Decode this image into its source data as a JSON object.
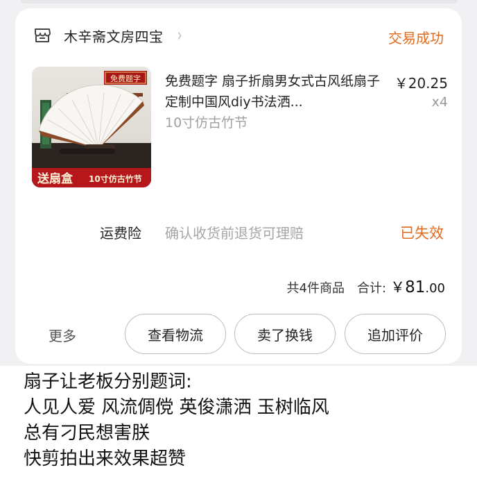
{
  "order": {
    "shop_name": "木辛斋文房四宝",
    "chevron": "›",
    "status": "交易成功",
    "item": {
      "title": "免费题字 扇子折扇男女式古风纸扇子定制中国风diy书法洒...",
      "sku": "10寸仿古竹节",
      "price": "￥20.25",
      "qty": "x4",
      "thumb_badge": "免费题字",
      "thumb_left_text": "送扇盒",
      "thumb_right_text": "10寸仿古竹节"
    },
    "insurance": {
      "label": "运费险",
      "desc": "确认收货前退货可理赔",
      "status": "已失效"
    },
    "summary": {
      "count": "共4件商品",
      "total_label": "合计:",
      "total_currency": "￥",
      "total_int": "81",
      "total_dec": ".00"
    },
    "actions": {
      "more": "更多",
      "logistics": "查看物流",
      "resell": "卖了换钱",
      "review": "追加评价"
    }
  },
  "caption": [
    "扇子让老板分别题词:",
    "人见人爱 风流倜傥 英俊潇洒 玉树临风",
    "总有刁民想害朕",
    "快剪拍出来效果超赞"
  ],
  "colors": {
    "accent": "#e26a1e",
    "background": "#f1f1f3",
    "card": "#ffffff"
  },
  "icons": {
    "shop": "shop-icon",
    "chevron": "chevron-right-icon"
  }
}
